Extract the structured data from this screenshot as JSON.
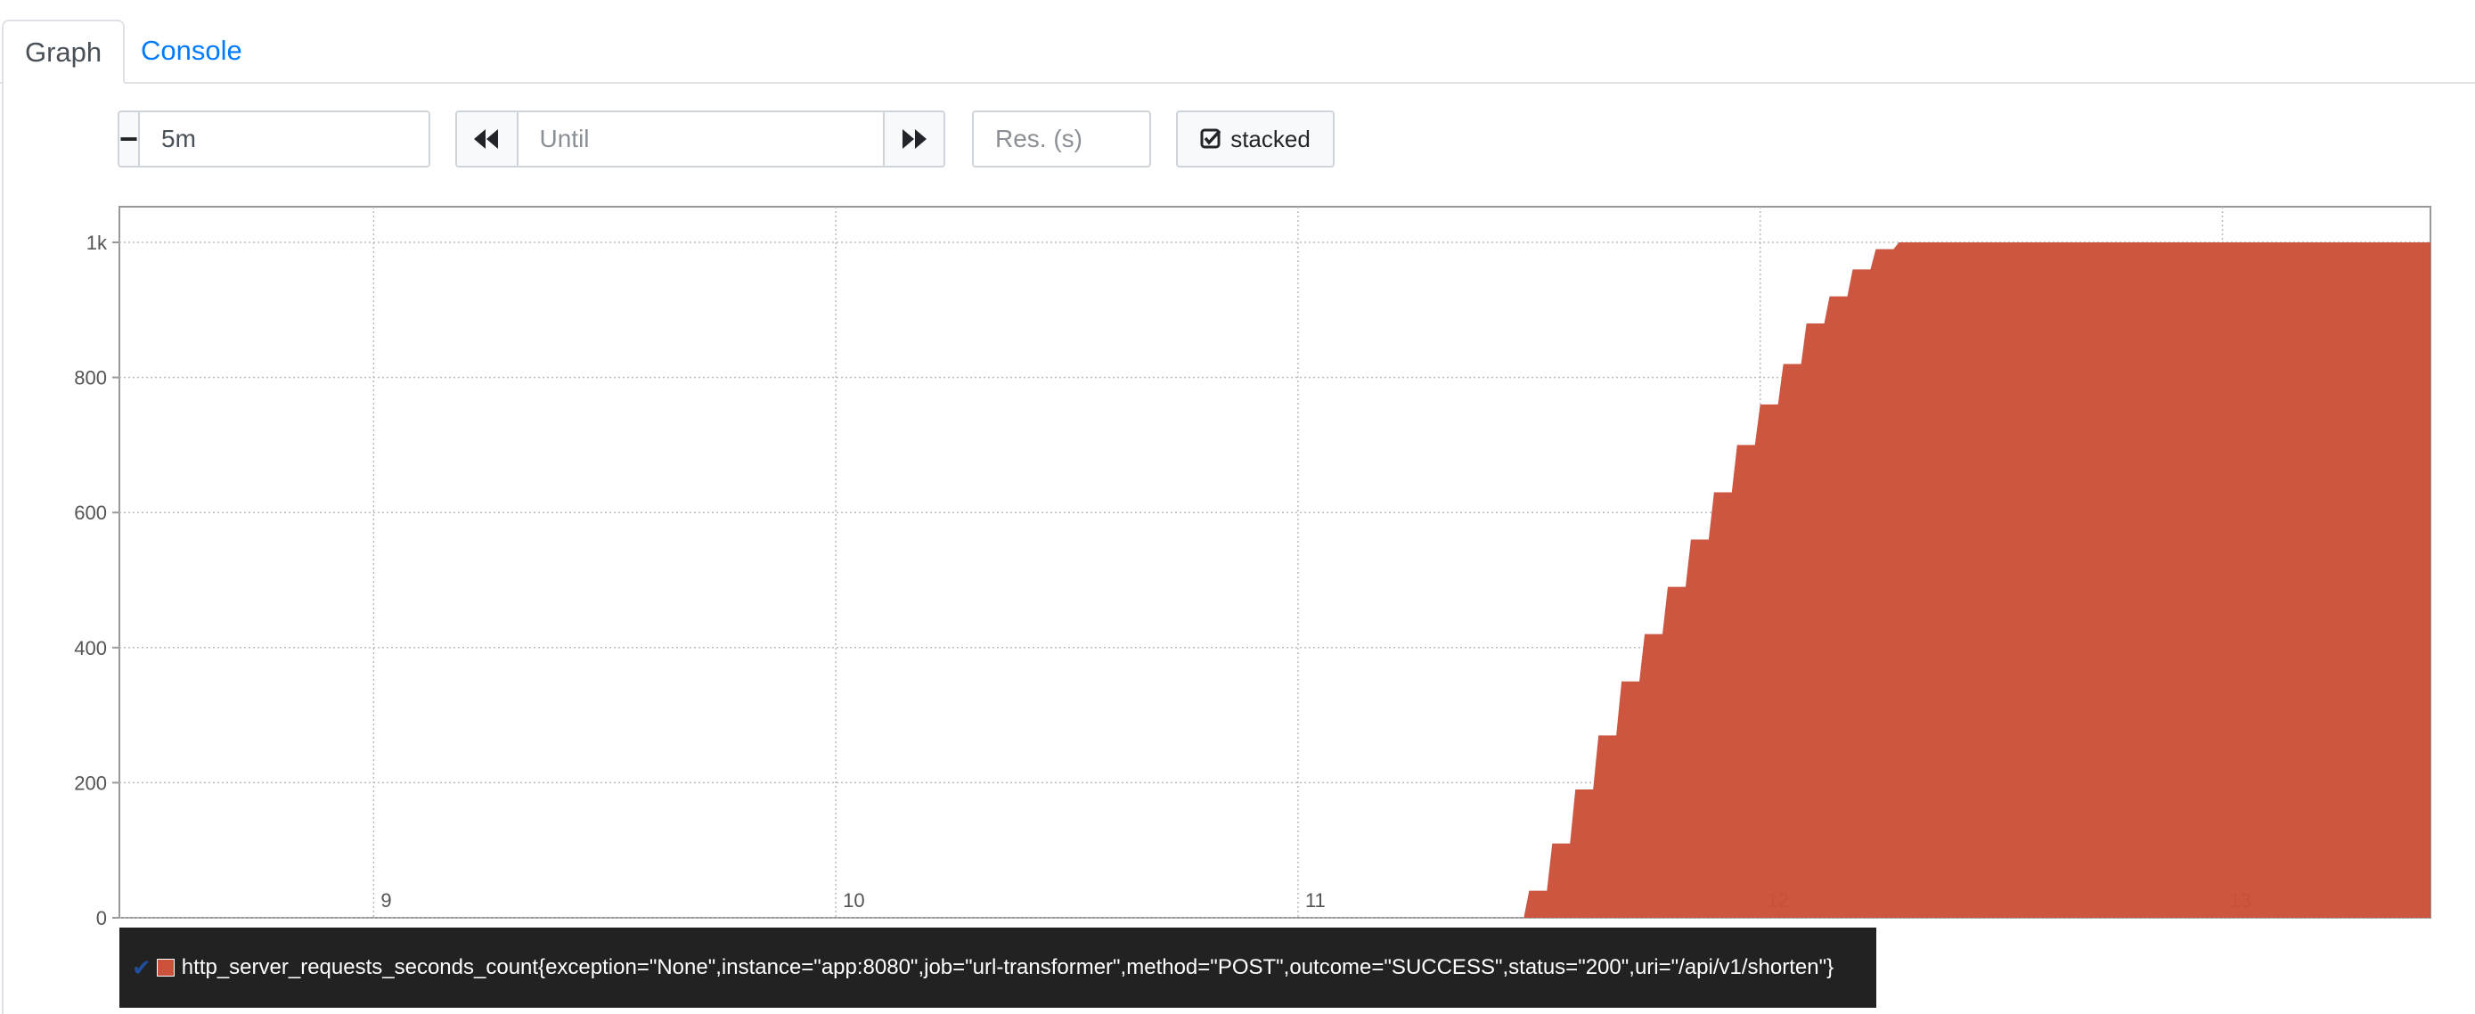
{
  "tabs": [
    {
      "label": "Graph",
      "active": true
    },
    {
      "label": "Console",
      "active": false
    }
  ],
  "controls": {
    "range_decrease_symbol": "−",
    "range_value": "5m",
    "range_increase_symbol": "+",
    "until_placeholder": "Until",
    "resolution_placeholder": "Res. (s)",
    "stacked_label": "stacked",
    "stacked_checked": true
  },
  "colors": {
    "series": "#cb513a",
    "link": "#007bff",
    "legend_bg": "#222222"
  },
  "chart_data": {
    "type": "area",
    "stacked": true,
    "grid": true,
    "xlim": [
      8.45,
      13.45
    ],
    "ylim": [
      0,
      1000
    ],
    "x_ticks": [
      9,
      10,
      11,
      12,
      13
    ],
    "x_tick_labels": [
      "9",
      "10",
      "11",
      "12",
      "13"
    ],
    "y_ticks": [
      0,
      200,
      400,
      600,
      800,
      1000
    ],
    "y_tick_labels": [
      "0",
      "200",
      "400",
      "600",
      "800",
      "1k"
    ],
    "series": [
      {
        "name": "http_server_requests_seconds_count{exception=\"None\",instance=\"app:8080\",job=\"url-transformer\",method=\"POST\",outcome=\"SUCCESS\",status=\"200\",uri=\"/api/v1/shorten\"}",
        "x": [
          11.45,
          11.5,
          11.55,
          11.6,
          11.65,
          11.7,
          11.75,
          11.8,
          11.85,
          11.9,
          11.95,
          12.0,
          12.05,
          12.1,
          12.15,
          12.2,
          12.25,
          12.3,
          12.35,
          12.4,
          13.0,
          13.45
        ],
        "y": [
          0,
          40,
          110,
          190,
          270,
          350,
          420,
          490,
          560,
          630,
          700,
          760,
          820,
          880,
          920,
          960,
          990,
          1000,
          1000,
          1000,
          1000,
          1000
        ]
      }
    ]
  },
  "legend": {
    "check_symbol": "✔"
  }
}
